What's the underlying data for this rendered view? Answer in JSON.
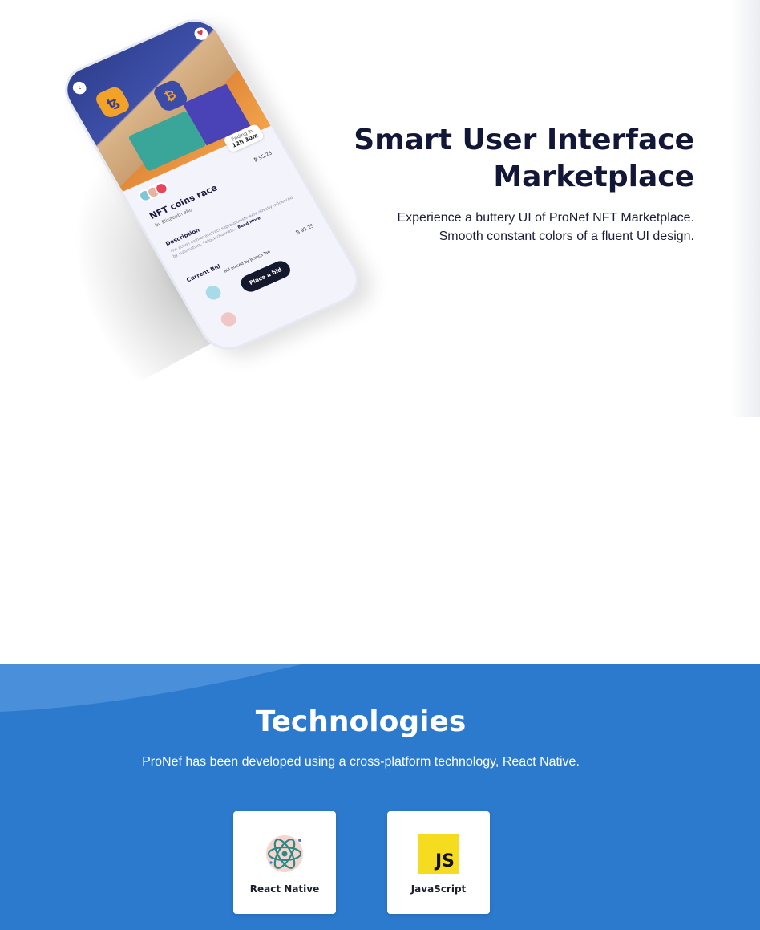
{
  "hero": {
    "title_line1": "Smart User Interface",
    "title_line2": "Marketplace",
    "desc_line1": "Experience a buttery UI of ProNef NFT Marketplace.",
    "desc_line2": "Smooth constant colors of a fluent UI design."
  },
  "phone": {
    "ending_label": "Ending in",
    "ending_value": "12h 30m",
    "nft_title": "NFT coins race",
    "nft_by": "by Elisabeth aho",
    "price": "₿ 95.25",
    "description_heading": "Description",
    "description_text": "The action painter abstract expressionists were directly influenced by automatism. Pollock channels...",
    "read_more": "Read More",
    "current_bid_heading": "Current Bid",
    "bid_placed_by": "Bid placed by Jessica Tan",
    "bid_price": "₿ 95.25",
    "bid_price2": "₿ 95.5",
    "place_bid_label": "Place a bid"
  },
  "technologies": {
    "title": "Technologies",
    "description": "ProNef has been developed using a cross-platform technology, React Native.",
    "cards": [
      {
        "label": "React Native",
        "icon": "react-logo-icon"
      },
      {
        "label": "JavaScript",
        "icon": "javascript-logo-icon",
        "logo_text": "JS"
      }
    ]
  },
  "colors": {
    "heading": "#121637",
    "tech_background": "#2c7acd",
    "js_yellow": "#f5dc1f"
  }
}
